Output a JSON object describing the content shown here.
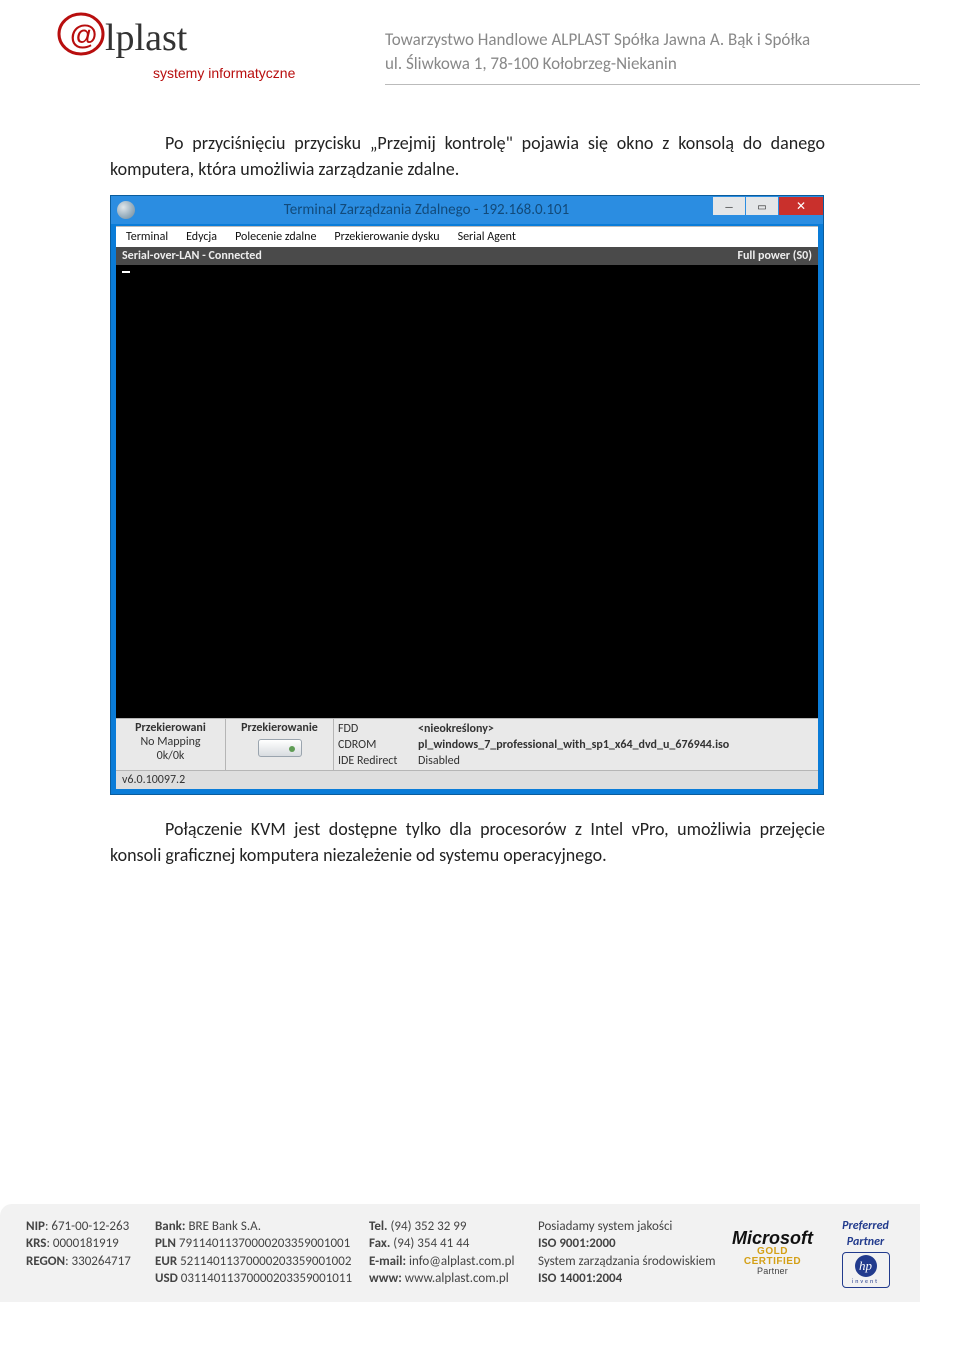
{
  "letterhead": {
    "logo_main": "lplast",
    "logo_sub": "systemy informatyczne",
    "company_line1": "Towarzystwo Handlowe ALPLAST Spółka Jawna A. Bąk i Spółka",
    "company_line2": "ul. Śliwkowa 1, 78-100 Kołobrzeg-Niekanin"
  },
  "paragraph1": "Po przyciśnięciu przycisku „Przejmij kontrolę\" pojawia się okno z konsolą do danego komputera, która umożliwia zarządzanie zdalne.",
  "screenshot": {
    "title": "Terminal Zarządzania Zdalnego - 192.168.0.101",
    "menu": [
      "Terminal",
      "Edycja",
      "Polecenie zdalne",
      "Przekierowanie dysku",
      "Serial Agent"
    ],
    "status_left": "Serial-over-LAN - Connected",
    "status_right": "Full power (S0)",
    "bottom": {
      "col1_hdr": "Przekierowani",
      "col1_v1": "No Mapping",
      "col1_v2": "0k/0k",
      "col2_hdr": "Przekierowanie",
      "rows": [
        {
          "k": "FDD",
          "v": "<nieokreślony>",
          "bold": true
        },
        {
          "k": "CDROM",
          "v": "pl_windows_7_professional_with_sp1_x64_dvd_u_676944.iso",
          "bold": true
        },
        {
          "k": "IDE Redirect",
          "v": "Disabled",
          "bold": false
        }
      ]
    },
    "version": "v6.0.10097.2"
  },
  "paragraph2": "Połączenie KVM jest dostępne tylko dla procesorów z Intel vPro, umożliwia przejęcie konsoli graficznej komputera niezależenie od systemu operacyjnego.",
  "footer": {
    "col1": [
      [
        "NIP",
        ": 671-00-12-263"
      ],
      [
        "KRS",
        ": 0000181919"
      ],
      [
        "REGON",
        ": 330264717"
      ]
    ],
    "col2": [
      [
        "Bank:",
        " BRE Bank S.A."
      ],
      [
        "PLN",
        " 79114011370000203359001001"
      ],
      [
        "EUR",
        " 52114011370000203359001002"
      ],
      [
        "USD",
        " 03114011370000203359001011"
      ]
    ],
    "col3": [
      [
        "Tel.",
        " (94) 352 32 99"
      ],
      [
        "Fax.",
        " (94) 354 41 44"
      ],
      [
        "E-mail:",
        " info@alplast.com.pl"
      ],
      [
        "www:",
        " www.alplast.com.pl"
      ]
    ],
    "col4": [
      "Posiadamy system jakości",
      "ISO 9001:2000",
      "System zarządzania środowiskiem",
      "ISO 14001:2004"
    ],
    "ms": {
      "brand": "Microsoft",
      "gold": "GOLD CERTIFIED",
      "partner": "Partner"
    },
    "hp": {
      "pp": "Preferred Partner",
      "hp": "hp",
      "invent": "invent"
    }
  }
}
